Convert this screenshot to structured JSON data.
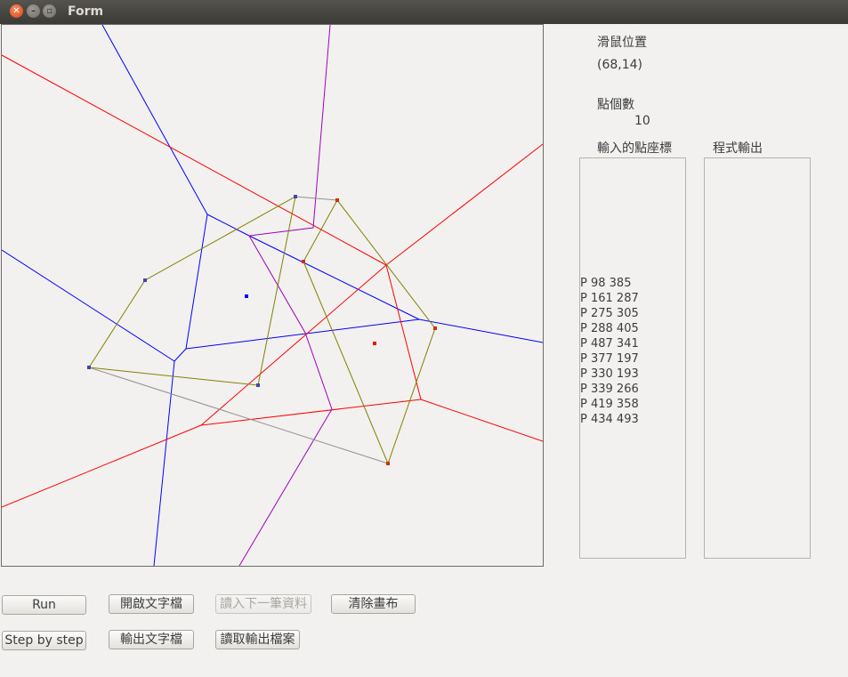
{
  "window": {
    "title": "Form",
    "controls": [
      "✕",
      "–",
      "▫"
    ]
  },
  "info": {
    "mouse_pos_label": "滑鼠位置",
    "mouse_pos_value": "(68,14)",
    "point_count_label": "點個數",
    "point_count_value": "10",
    "input_label": "輸入的點座標",
    "output_label": "程式輸出"
  },
  "input_points": [
    "P 98 385",
    "P 161 287",
    "P 275 305",
    "P 288 405",
    "P 487 341",
    "P 377 197",
    "P 330 193",
    "P 339 266",
    "P 419 358",
    "P 434 493"
  ],
  "output_lines": [],
  "buttons": {
    "run": "Run",
    "open_text": "開啟文字檔",
    "read_next": "讀入下一筆資料",
    "clear_canvas": "清除畫布",
    "step": "Step by step",
    "export_text": "輸出文字檔",
    "read_output": "讀取輸出檔案"
  },
  "colors": {
    "voronoi_left": "#0000ff",
    "voronoi_right": "#ff0000",
    "hyperplane": "#a000c0",
    "hull": "#808000",
    "hull_joint": "#909090"
  }
}
